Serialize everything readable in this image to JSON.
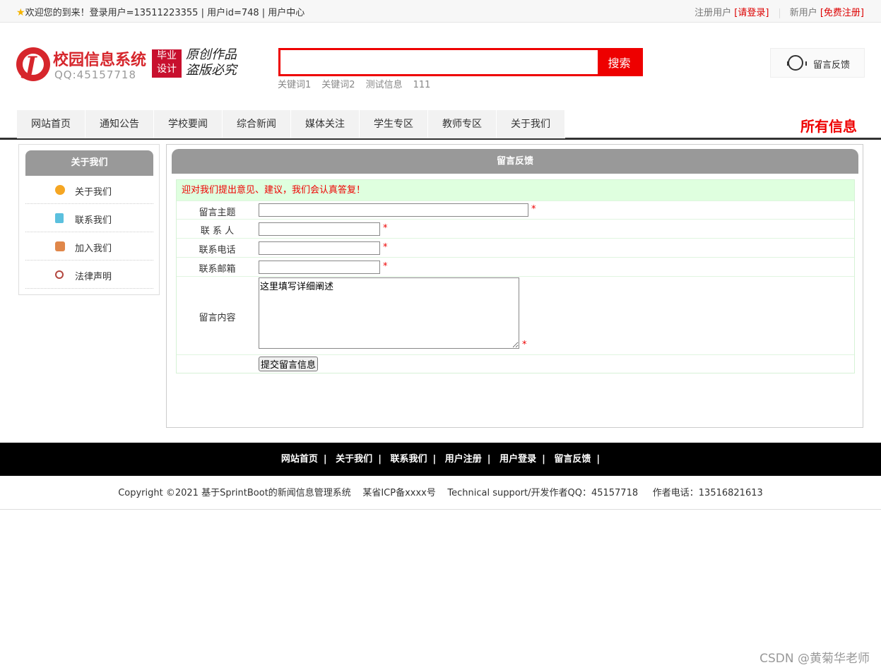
{
  "topbar": {
    "welcome": "欢迎您的到来！登录用户=13511223355 | 用户id=748 | 用户中心",
    "registered_label": "注册用户",
    "login_link": "[请登录]",
    "new_user_label": "新用户",
    "register_link": "[免费注册]"
  },
  "logo": {
    "mark": "J",
    "title": "校园信息系统",
    "qq": "QQ:45157718",
    "badge_line1": "毕业",
    "badge_line2": "设计",
    "slogan_line1": "原创作品",
    "slogan_line2": "盗版必究"
  },
  "search": {
    "value": "",
    "button": "搜索",
    "keywords": [
      "关键词1",
      "关键词2",
      "测试信息",
      "111"
    ]
  },
  "feedback_box": {
    "label": "留言反馈"
  },
  "nav": {
    "items": [
      "网站首页",
      "通知公告",
      "学校要闻",
      "综合新闻",
      "媒体关注",
      "学生专区",
      "教师专区",
      "关于我们"
    ],
    "all_info": "所有信息"
  },
  "sidebar": {
    "title": "关于我们",
    "items": [
      {
        "label": "关于我们",
        "icon": "orange-dot-icon"
      },
      {
        "label": "联系我们",
        "icon": "clipboard-icon"
      },
      {
        "label": "加入我们",
        "icon": "lock-icon"
      },
      {
        "label": "法律声明",
        "icon": "power-icon"
      }
    ]
  },
  "main": {
    "title": "留言反馈",
    "tip": "迎对我们提出意见、建议，我们会认真答复！",
    "fields": {
      "subject": {
        "label": "留言主题",
        "value": ""
      },
      "contact": {
        "label": "联 系 人",
        "value": ""
      },
      "phone": {
        "label": "联系电话",
        "value": ""
      },
      "email": {
        "label": "联系邮箱",
        "value": ""
      },
      "content": {
        "label": "留言内容",
        "value": "这里填写详细阐述"
      }
    },
    "required_mark": "*",
    "submit": "提交留言信息"
  },
  "footer": {
    "links": [
      "网站首页",
      "关于我们",
      "联系我们",
      "用户注册",
      "用户登录",
      "留言反馈"
    ],
    "separator": "|",
    "copyright": "Copyright ©2021 基于SprintBoot的新闻信息管理系统    某省ICP备xxxx号    Technical support/开发作者QQ：45157718     作者电话：13516821613"
  },
  "watermark": "CSDN @黄菊华老师",
  "colors": {
    "accent": "#ee0000",
    "brand": "#d6262c",
    "header_gray": "#999999"
  }
}
